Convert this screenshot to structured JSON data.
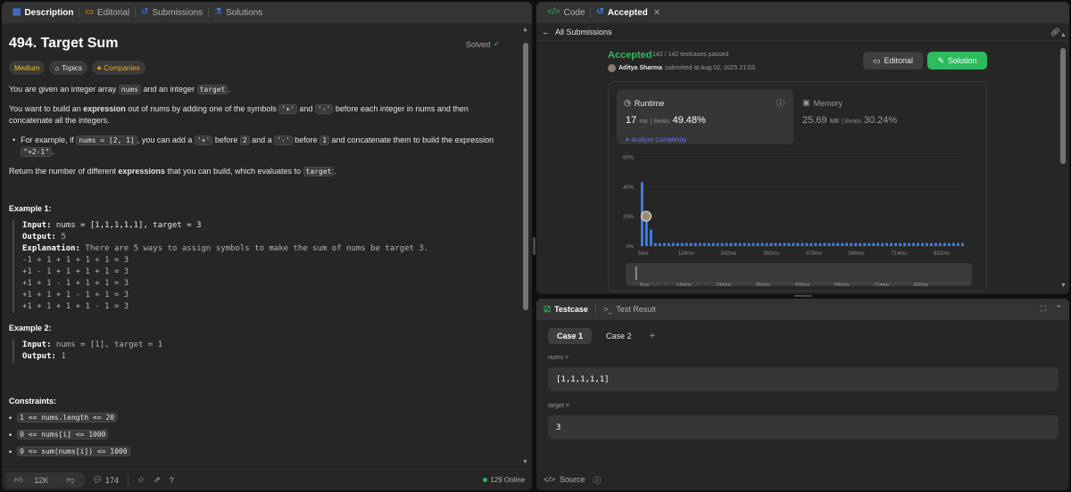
{
  "left_tabs": [
    {
      "label": "Description",
      "icon": "description-icon",
      "active": true
    },
    {
      "label": "Editorial",
      "icon": "book-icon",
      "active": false
    },
    {
      "label": "Submissions",
      "icon": "history-icon",
      "active": false
    },
    {
      "label": "Solutions",
      "icon": "flask-icon",
      "active": false
    }
  ],
  "problem": {
    "title": "494. Target Sum",
    "status": "Solved",
    "chips": {
      "difficulty": "Medium",
      "topics": "Topics",
      "companies": "Companies"
    },
    "p1": {
      "a": "You are given an integer array ",
      "c1": "nums",
      "b": " and an integer ",
      "c2": "target",
      "d": "."
    },
    "p2": {
      "a": "You want to build an ",
      "bold": "expression",
      "b": " out of nums by adding one of the symbols ",
      "c1": "'+'",
      "c": " and ",
      "c2": "'-'",
      "d": " before each integer in nums and then concatenate all the integers."
    },
    "bullet": {
      "a": "For example, if ",
      "c1": "nums = [2, 1]",
      "b": ", you can add a ",
      "c2": "'+'",
      "c": " before ",
      "c3": "2",
      "d": " and a ",
      "c4": "'-'",
      "e": " before ",
      "c5": "1",
      "f": " and concatenate them to build the expression ",
      "c6": "\"+2-1\"",
      "g": "."
    },
    "p3": {
      "a": "Return the number of different ",
      "bold": "expressions",
      "b": " that you can build, which evaluates to ",
      "c1": "target",
      "d": "."
    },
    "example1": {
      "title": "Example 1:",
      "input_label": "Input:",
      "input": " nums = [1,1,1,1,1], target = 3",
      "output_label": "Output:",
      "output": " 5",
      "expl_label": "Explanation:",
      "expl": " There are 5 ways to assign symbols to make the sum of nums be target 3.",
      "lines": [
        "-1 + 1 + 1 + 1 + 1 = 3",
        "+1 - 1 + 1 + 1 + 1 = 3",
        "+1 + 1 - 1 + 1 + 1 = 3",
        "+1 + 1 + 1 - 1 + 1 = 3",
        "+1 + 1 + 1 + 1 - 1 = 3"
      ]
    },
    "example2": {
      "title": "Example 2:",
      "input_label": "Input:",
      "input": " nums = [1], target = 1",
      "output_label": "Output:",
      "output": " 1"
    },
    "constraints_title": "Constraints:",
    "constraints": [
      "1 <= nums.length <= 20",
      "0 <= nums[i] <= 1000",
      "0 <= sum(nums[i]) <= 1000"
    ]
  },
  "left_footer": {
    "likes": "12K",
    "comments": "174",
    "online": "129 Online"
  },
  "right_tabs": {
    "code": "Code",
    "accepted": "Accepted"
  },
  "all_submissions": "All Submissions",
  "submission": {
    "status": "Accepted",
    "testcases": "142 / 142 testcases passed",
    "user": "Aditya Sharma",
    "submitted": "submitted at Aug 02, 2025 21:03",
    "editorial_btn": "Editorial",
    "solution_btn": "Solution"
  },
  "runtime": {
    "label": "Runtime",
    "value": "17",
    "unit": "ms",
    "beats_label": "Beats",
    "beats": "49.48%",
    "analyze": "Analyze Complexity"
  },
  "memory": {
    "label": "Memory",
    "value": "25.69",
    "unit": "MB",
    "beats_label": "Beats",
    "beats": "30.24%"
  },
  "chart_data": {
    "type": "bar",
    "ylabel_ticks": [
      "60%",
      "40%",
      "20%",
      "0%"
    ],
    "ylim": [
      0,
      60
    ],
    "x_ticks": [
      "5ms",
      "124ms",
      "242ms",
      "360ms",
      "478ms",
      "596ms",
      "714ms",
      "832ms"
    ],
    "series": [
      {
        "values": [
          43,
          20,
          11,
          2,
          2,
          2,
          2,
          2,
          2,
          2,
          2,
          2,
          2,
          2,
          2,
          2,
          2,
          2,
          2,
          2,
          2,
          2,
          2,
          2,
          2,
          2,
          2,
          2,
          2,
          2,
          2,
          2,
          2,
          2,
          2,
          2,
          2,
          2,
          2,
          2,
          2,
          2,
          2,
          2,
          2,
          2,
          2,
          2,
          2,
          2,
          2,
          2,
          2,
          2,
          2,
          2,
          2,
          2,
          2,
          2,
          2,
          2,
          2,
          2,
          2,
          2,
          2,
          2,
          2,
          2,
          2,
          2,
          2
        ]
      }
    ],
    "highlight_index": 1,
    "brush_ticks": [
      "5ms",
      "124ms",
      "242ms",
      "360ms",
      "478ms",
      "596ms",
      "714ms",
      "832ms"
    ],
    "colors": {
      "bar": "#3b82f6",
      "grid": "#3a3a3a"
    }
  },
  "testcase": {
    "tab_testcase": "Testcase",
    "tab_result": "Test Result",
    "cases": [
      "Case 1",
      "Case 2"
    ],
    "fields": [
      {
        "label": "nums =",
        "value": "[1,1,1,1,1]"
      },
      {
        "label": "target =",
        "value": "3"
      }
    ],
    "source": "Source"
  },
  "colors": {
    "accent_green": "#2cbb5d",
    "medium": "#ffc01e",
    "panel": "#262626",
    "link_purple": "#6b6ff0"
  }
}
